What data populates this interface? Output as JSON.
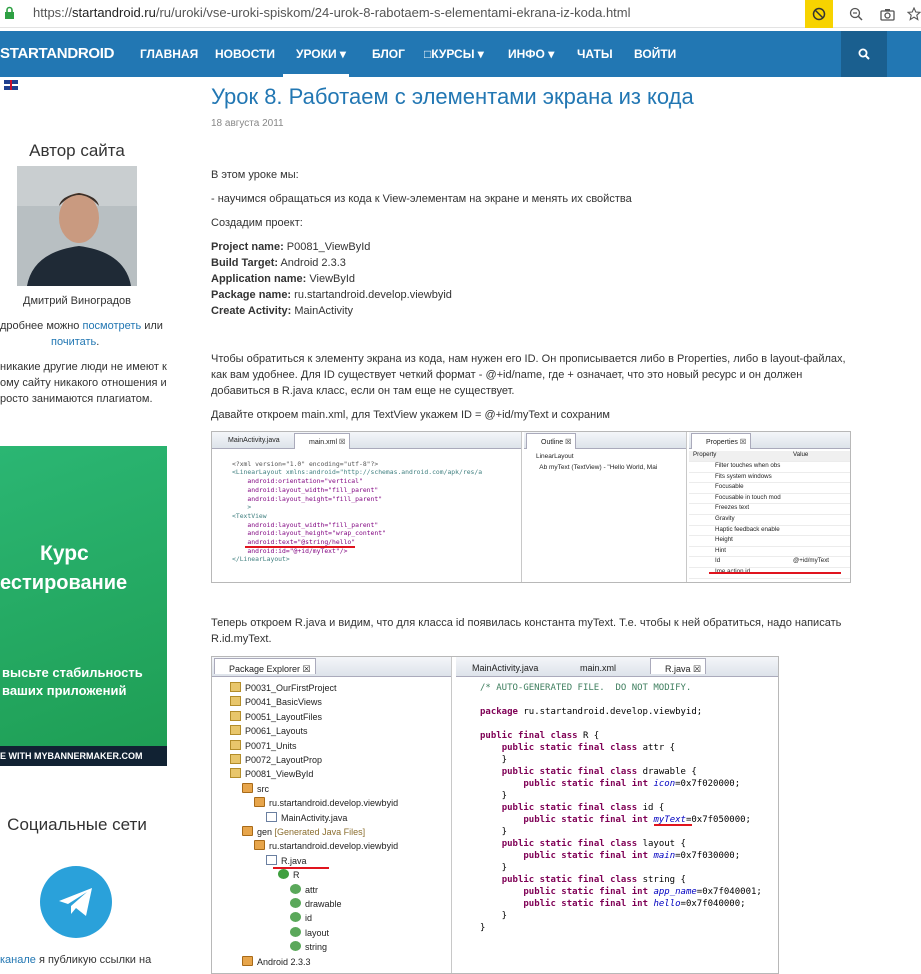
{
  "browser": {
    "url_scheme": "https://",
    "url_host": "startandroid.ru",
    "url_path": "/ru/uroki/vse-uroki-spiskom/24-urok-8-rabotaem-s-elementami-ekrana-iz-koda.html"
  },
  "nav": {
    "brand": "STARTANDROID",
    "items": [
      "ГЛАВНАЯ",
      "НОВОСТИ",
      "УРОКИ ▾",
      "БЛОГ",
      "□КУРСЫ ▾",
      "ИНФО ▾",
      "ЧАТЫ",
      "ВОЙТИ"
    ],
    "active_index": 2
  },
  "sidebar": {
    "author_title": "Автор сайта",
    "author_name": "Дмитрий Виноградов",
    "more_text_1": "дробнее можно ",
    "more_link_1": "посмотреть",
    "more_text_2": " или",
    "more_link_2": "почитать",
    "more_text_3": ".",
    "note_lines": [
      "никакие другие люди не имеют к",
      "ому сайту никакого отношения и",
      "росто занимаются плагиатом."
    ],
    "banner": {
      "line1": "Курс",
      "line2": "естирование",
      "line3": "высьте стабильность",
      "line4": "ваших приложений",
      "footer": "E WITH MYBANNERMAKER.COM"
    },
    "social_title": "Социальные сети",
    "channel_link": "канале",
    "channel_text": " я публикую ссылки на"
  },
  "article": {
    "title": "Урок 8. Работаем с элементами экрана из кода",
    "date": "18 августа 2011",
    "intro": "В этом уроке мы:",
    "bullet": "- научимся обращаться из кода к View-элементам на экране и менять их свойства",
    "create": "Создадим проект:",
    "project": [
      {
        "label": "Project name:",
        "value": " P0081_ViewById"
      },
      {
        "label": "Build Target:",
        "value": " Android 2.3.3"
      },
      {
        "label": "Application name:",
        "value": " ViewById"
      },
      {
        "label": "Package name:",
        "value": " ru.startandroid.develop.viewbyid"
      },
      {
        "label": "Create Activity:",
        "value": " MainActivity"
      }
    ],
    "para1": [
      "Чтобы обратиться к элементу экрана из кода, нам нужен его ID. Он прописывается либо в Properties, либо в layout-файлах,",
      "как вам удобнее. Для ID существует четкий формат - @+id/name, где + означает, что это новый ресурс и он должен",
      "добавиться в R.java класс, если он там еще не существует."
    ],
    "para2": "Давайте откроем main.xml, для TextView укажем ID = @+id/myText и сохраним",
    "para3": [
      "Теперь откроем R.java и видим, что для класса id появилась константа myText. Т.е. чтобы к ней обратиться, надо написать",
      "R.id.myText."
    ]
  },
  "shot1": {
    "tabs": [
      "MainActivity.java",
      "main.xml ☒"
    ],
    "xml_lines": [
      "<?xml version=\"1.0\" encoding=\"utf-8\"?>",
      "<LinearLayout xmlns:android=\"http://schemas.android.com/apk/res/a",
      "    android:orientation=\"vertical\"",
      "    android:layout_width=\"fill_parent\"",
      "    android:layout_height=\"fill_parent\"",
      "    >",
      "<TextView",
      "    android:layout_width=\"fill_parent\"",
      "    android:layout_height=\"wrap_content\"",
      "    android:text=\"@string/hello\"",
      "    android:id=\"@+id/myText\"/>",
      "</LinearLayout>"
    ],
    "outline_title": "Outline ☒",
    "outline_items": [
      "LinearLayout",
      "Ab myText (TextView) - \"Hello World, Mai"
    ],
    "props_title": "Properties ☒",
    "props_head": [
      "Property",
      "Value"
    ],
    "props": [
      {
        "k": "Filter touches when obs",
        "v": ""
      },
      {
        "k": "Fits system windows",
        "v": ""
      },
      {
        "k": "Focusable",
        "v": ""
      },
      {
        "k": "Focusable in touch mod",
        "v": ""
      },
      {
        "k": "Freezes text",
        "v": ""
      },
      {
        "k": "Gravity",
        "v": ""
      },
      {
        "k": "Haptic feedback enable",
        "v": ""
      },
      {
        "k": "Height",
        "v": ""
      },
      {
        "k": "Hint",
        "v": ""
      },
      {
        "k": "Id",
        "v": "@+id/myText"
      },
      {
        "k": "Ime action id",
        "v": ""
      }
    ]
  },
  "shot2": {
    "explorer_title": "Package Explorer ☒",
    "tree": [
      {
        "t": "P0031_OurFirstProject",
        "d": 1,
        "ic": "proj"
      },
      {
        "t": "P0041_BasicViews",
        "d": 1,
        "ic": "proj"
      },
      {
        "t": "P0051_LayoutFiles",
        "d": 1,
        "ic": "proj"
      },
      {
        "t": "P0061_Layouts",
        "d": 1,
        "ic": "proj"
      },
      {
        "t": "P0071_Units",
        "d": 1,
        "ic": "proj"
      },
      {
        "t": "P0072_LayoutProp",
        "d": 1,
        "ic": "proj"
      },
      {
        "t": "P0081_ViewById",
        "d": 1,
        "ic": "proj"
      },
      {
        "t": "src",
        "d": 2,
        "ic": "pkg"
      },
      {
        "t": "ru.startandroid.develop.viewbyid",
        "d": 3,
        "ic": "pkg"
      },
      {
        "t": "MainActivity.java",
        "d": 4,
        "ic": "file"
      },
      {
        "t": "gen",
        "g": " [Generated Java Files]",
        "d": 2,
        "ic": "pkg"
      },
      {
        "t": "ru.startandroid.develop.viewbyid",
        "d": 3,
        "ic": "pkg"
      },
      {
        "t": "R.java",
        "d": 4,
        "ic": "file"
      },
      {
        "t": "R",
        "d": 5,
        "ic": "class"
      },
      {
        "t": "attr",
        "d": 6,
        "ic": "inner"
      },
      {
        "t": "drawable",
        "d": 6,
        "ic": "inner"
      },
      {
        "t": "id",
        "d": 6,
        "ic": "inner"
      },
      {
        "t": "layout",
        "d": 6,
        "ic": "inner"
      },
      {
        "t": "string",
        "d": 6,
        "ic": "inner"
      },
      {
        "t": "Android 2.3.3",
        "d": 2,
        "ic": "pkg"
      }
    ],
    "tabs": [
      "MainActivity.java",
      "main.xml",
      "R.java ☒"
    ],
    "code": [
      {
        "c": "/* AUTO-GENERATED FILE.  DO NOT MODIFY.",
        "k": "cmt"
      },
      {
        "c": "",
        "k": ""
      },
      {
        "c": "package ru.startandroid.develop.viewbyid;",
        "k": "pkg"
      },
      {
        "c": "",
        "k": ""
      },
      {
        "c": "public final class R {",
        "k": "cls"
      },
      {
        "c": "    public static final class attr {",
        "k": "cls"
      },
      {
        "c": "    }",
        "k": ""
      },
      {
        "c": "    public static final class drawable {",
        "k": "cls"
      },
      {
        "c": "        public static final int icon=0x7f020000;",
        "k": "fld",
        "n": "icon"
      },
      {
        "c": "    }",
        "k": ""
      },
      {
        "c": "    public static final class id {",
        "k": "cls"
      },
      {
        "c": "        public static final int myText=0x7f050000;",
        "k": "fld",
        "n": "myText"
      },
      {
        "c": "    }",
        "k": ""
      },
      {
        "c": "    public static final class layout {",
        "k": "cls"
      },
      {
        "c": "        public static final int main=0x7f030000;",
        "k": "fld",
        "n": "main"
      },
      {
        "c": "    }",
        "k": ""
      },
      {
        "c": "    public static final class string {",
        "k": "cls"
      },
      {
        "c": "        public static final int app_name=0x7f040001;",
        "k": "fld",
        "n": "app_name"
      },
      {
        "c": "        public static final int hello=0x7f040000;",
        "k": "fld",
        "n": "hello"
      },
      {
        "c": "    }",
        "k": ""
      },
      {
        "c": "}",
        "k": ""
      }
    ]
  },
  "colors": {
    "nav": "#2277b3",
    "link": "#2277b3",
    "banner": "#2bb673",
    "telegram": "#2aa1da",
    "highlight": "#e0141e"
  }
}
